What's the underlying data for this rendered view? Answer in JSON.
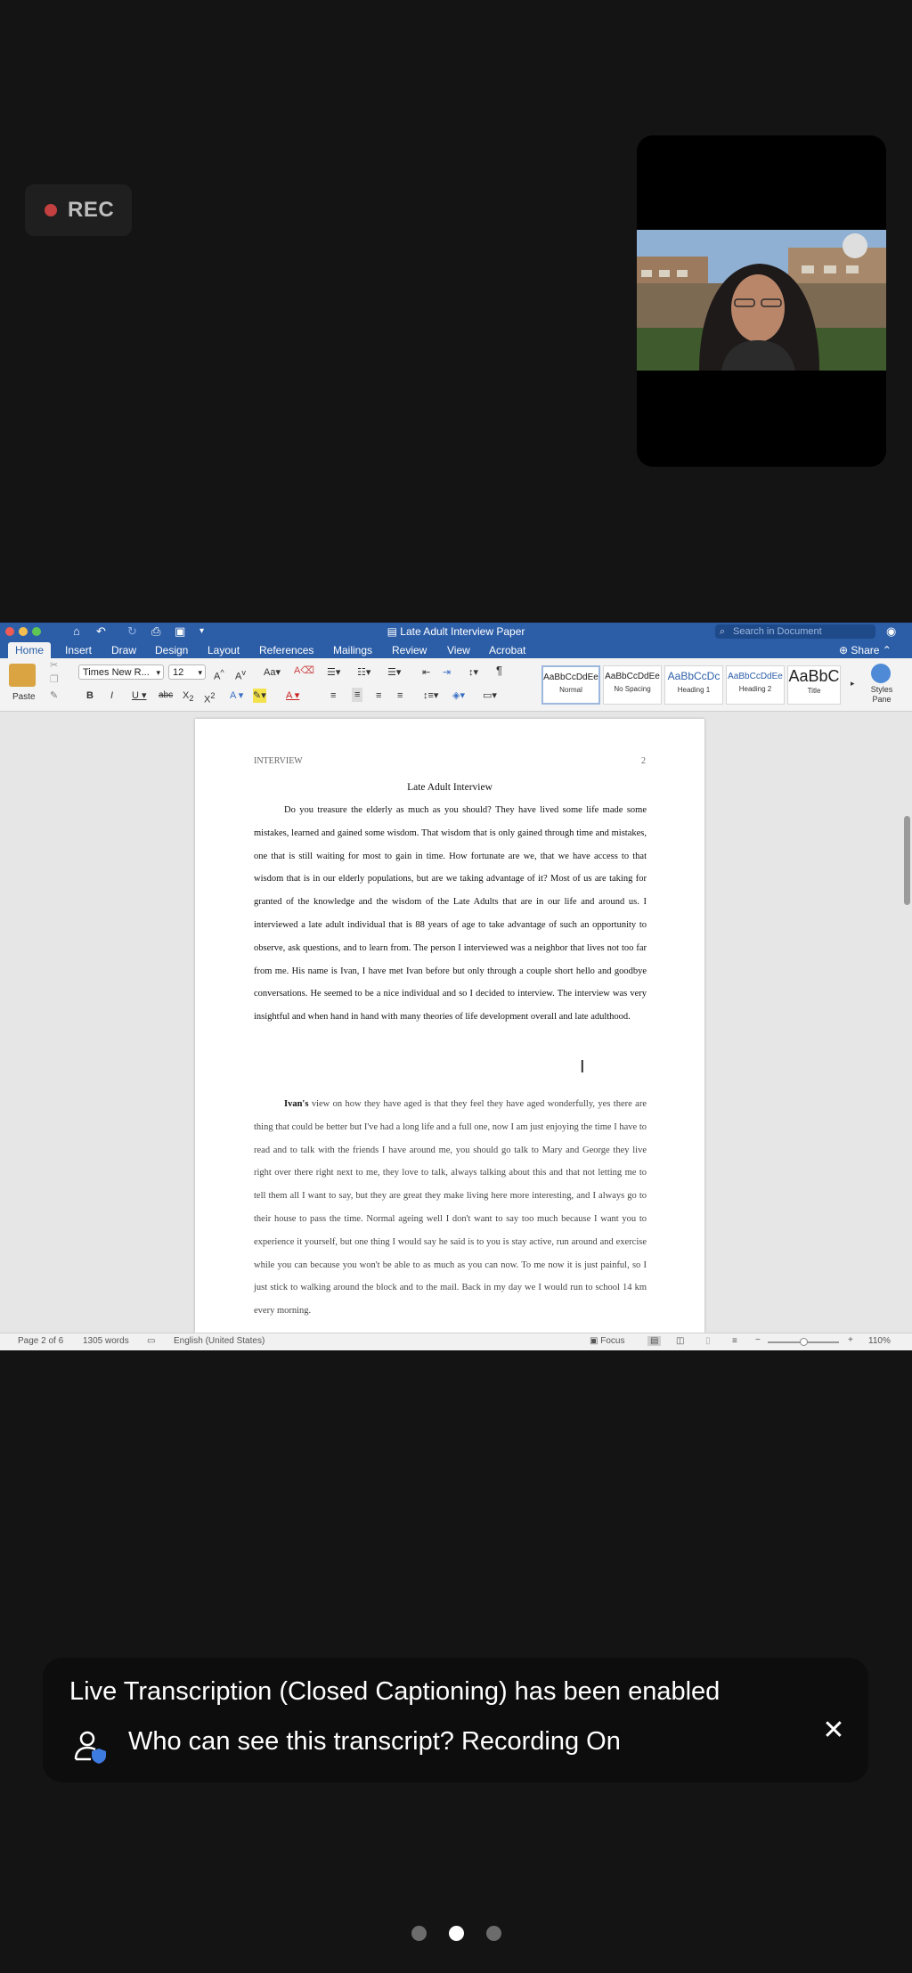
{
  "meeting": {
    "rec_label": "REC",
    "rec_color": "#c2403f"
  },
  "word": {
    "doc_title": "Late Adult Interview Paper",
    "search_placeholder": "Search in Document",
    "tabs": [
      "Home",
      "Insert",
      "Draw",
      "Design",
      "Layout",
      "References",
      "Mailings",
      "Review",
      "View",
      "Acrobat"
    ],
    "active_tab": "Home",
    "share_label": "Share",
    "ribbon": {
      "paste_label": "Paste",
      "font_name": "Times New R...",
      "font_size": "12",
      "styles_pane_label": "Styles Pane",
      "styles": [
        {
          "preview": "AaBbCcDdEe",
          "name": "Normal"
        },
        {
          "preview": "AaBbCcDdEe",
          "name": "No Spacing"
        },
        {
          "preview": "AaBbCcDc",
          "name": "Heading 1"
        },
        {
          "preview": "AaBbCcDdEe",
          "name": "Heading 2"
        },
        {
          "preview": "AaBbC",
          "name": "Title"
        }
      ]
    },
    "document": {
      "running_head": "INTERVIEW",
      "page_number": "2",
      "title": "Late Adult Interview",
      "paragraph1": "Do you treasure the elderly as much as you should? They have lived some life made some mistakes, learned and gained some wisdom. That wisdom that is only gained through time and mistakes, one that is still waiting for most to gain in time. How fortunate are we, that we have access to that wisdom that is in our elderly populations, but are we taking advantage of it? Most of us are taking for granted of the knowledge and the wisdom of the Late Adults that are in our life and around us. I interviewed a late adult individual that is 88 years of age to take advantage of such an opportunity to observe, ask questions, and to learn from. The person I interviewed was a neighbor that lives not too far from me. His name is Ivan, I have met Ivan before but only through a couple short hello and goodbye conversations. He seemed to be a nice individual and so I decided to interview. The interview was very insightful and when hand in hand with many theories of life development overall and late adulthood.",
      "paragraph2_lead": "Ivan's",
      "paragraph2_rest": " view on how they have aged is that they feel they have aged wonderfully, yes there are thing that could be better but I've had a long life and a full one, now I am just enjoying the time I have to read and to talk with the friends I have around me, you should go talk to Mary and George they live right over there right next to me, they love to talk, always talking about this and that not letting me to tell them all I want to say, but they are great they make living here more interesting, and I always go to their house to pass the time. Normal ageing well I don't want to say too much because I want you to experience it yourself, but one thing I would say he said is to you is stay active, run around and exercise while you can because you won't be able to as much as you can now. To me now it is just painful, so I just stick to walking around the block and to the mail. Back in my day we I would run to school 14 km every morning."
    },
    "status": {
      "page": "Page 2 of 6",
      "words": "1305 words",
      "language": "English (United States)",
      "focus": "Focus",
      "zoom": "110%"
    },
    "accent_color": "#2c5ea8"
  },
  "caption": {
    "line1": "Live Transcription (Closed Captioning) has been enabled",
    "line2": "Who can see this transcript? Recording On",
    "close_icon": "close-icon",
    "user_icon": "user-shield-icon"
  },
  "pager": {
    "count": 3,
    "active_index": 1
  }
}
